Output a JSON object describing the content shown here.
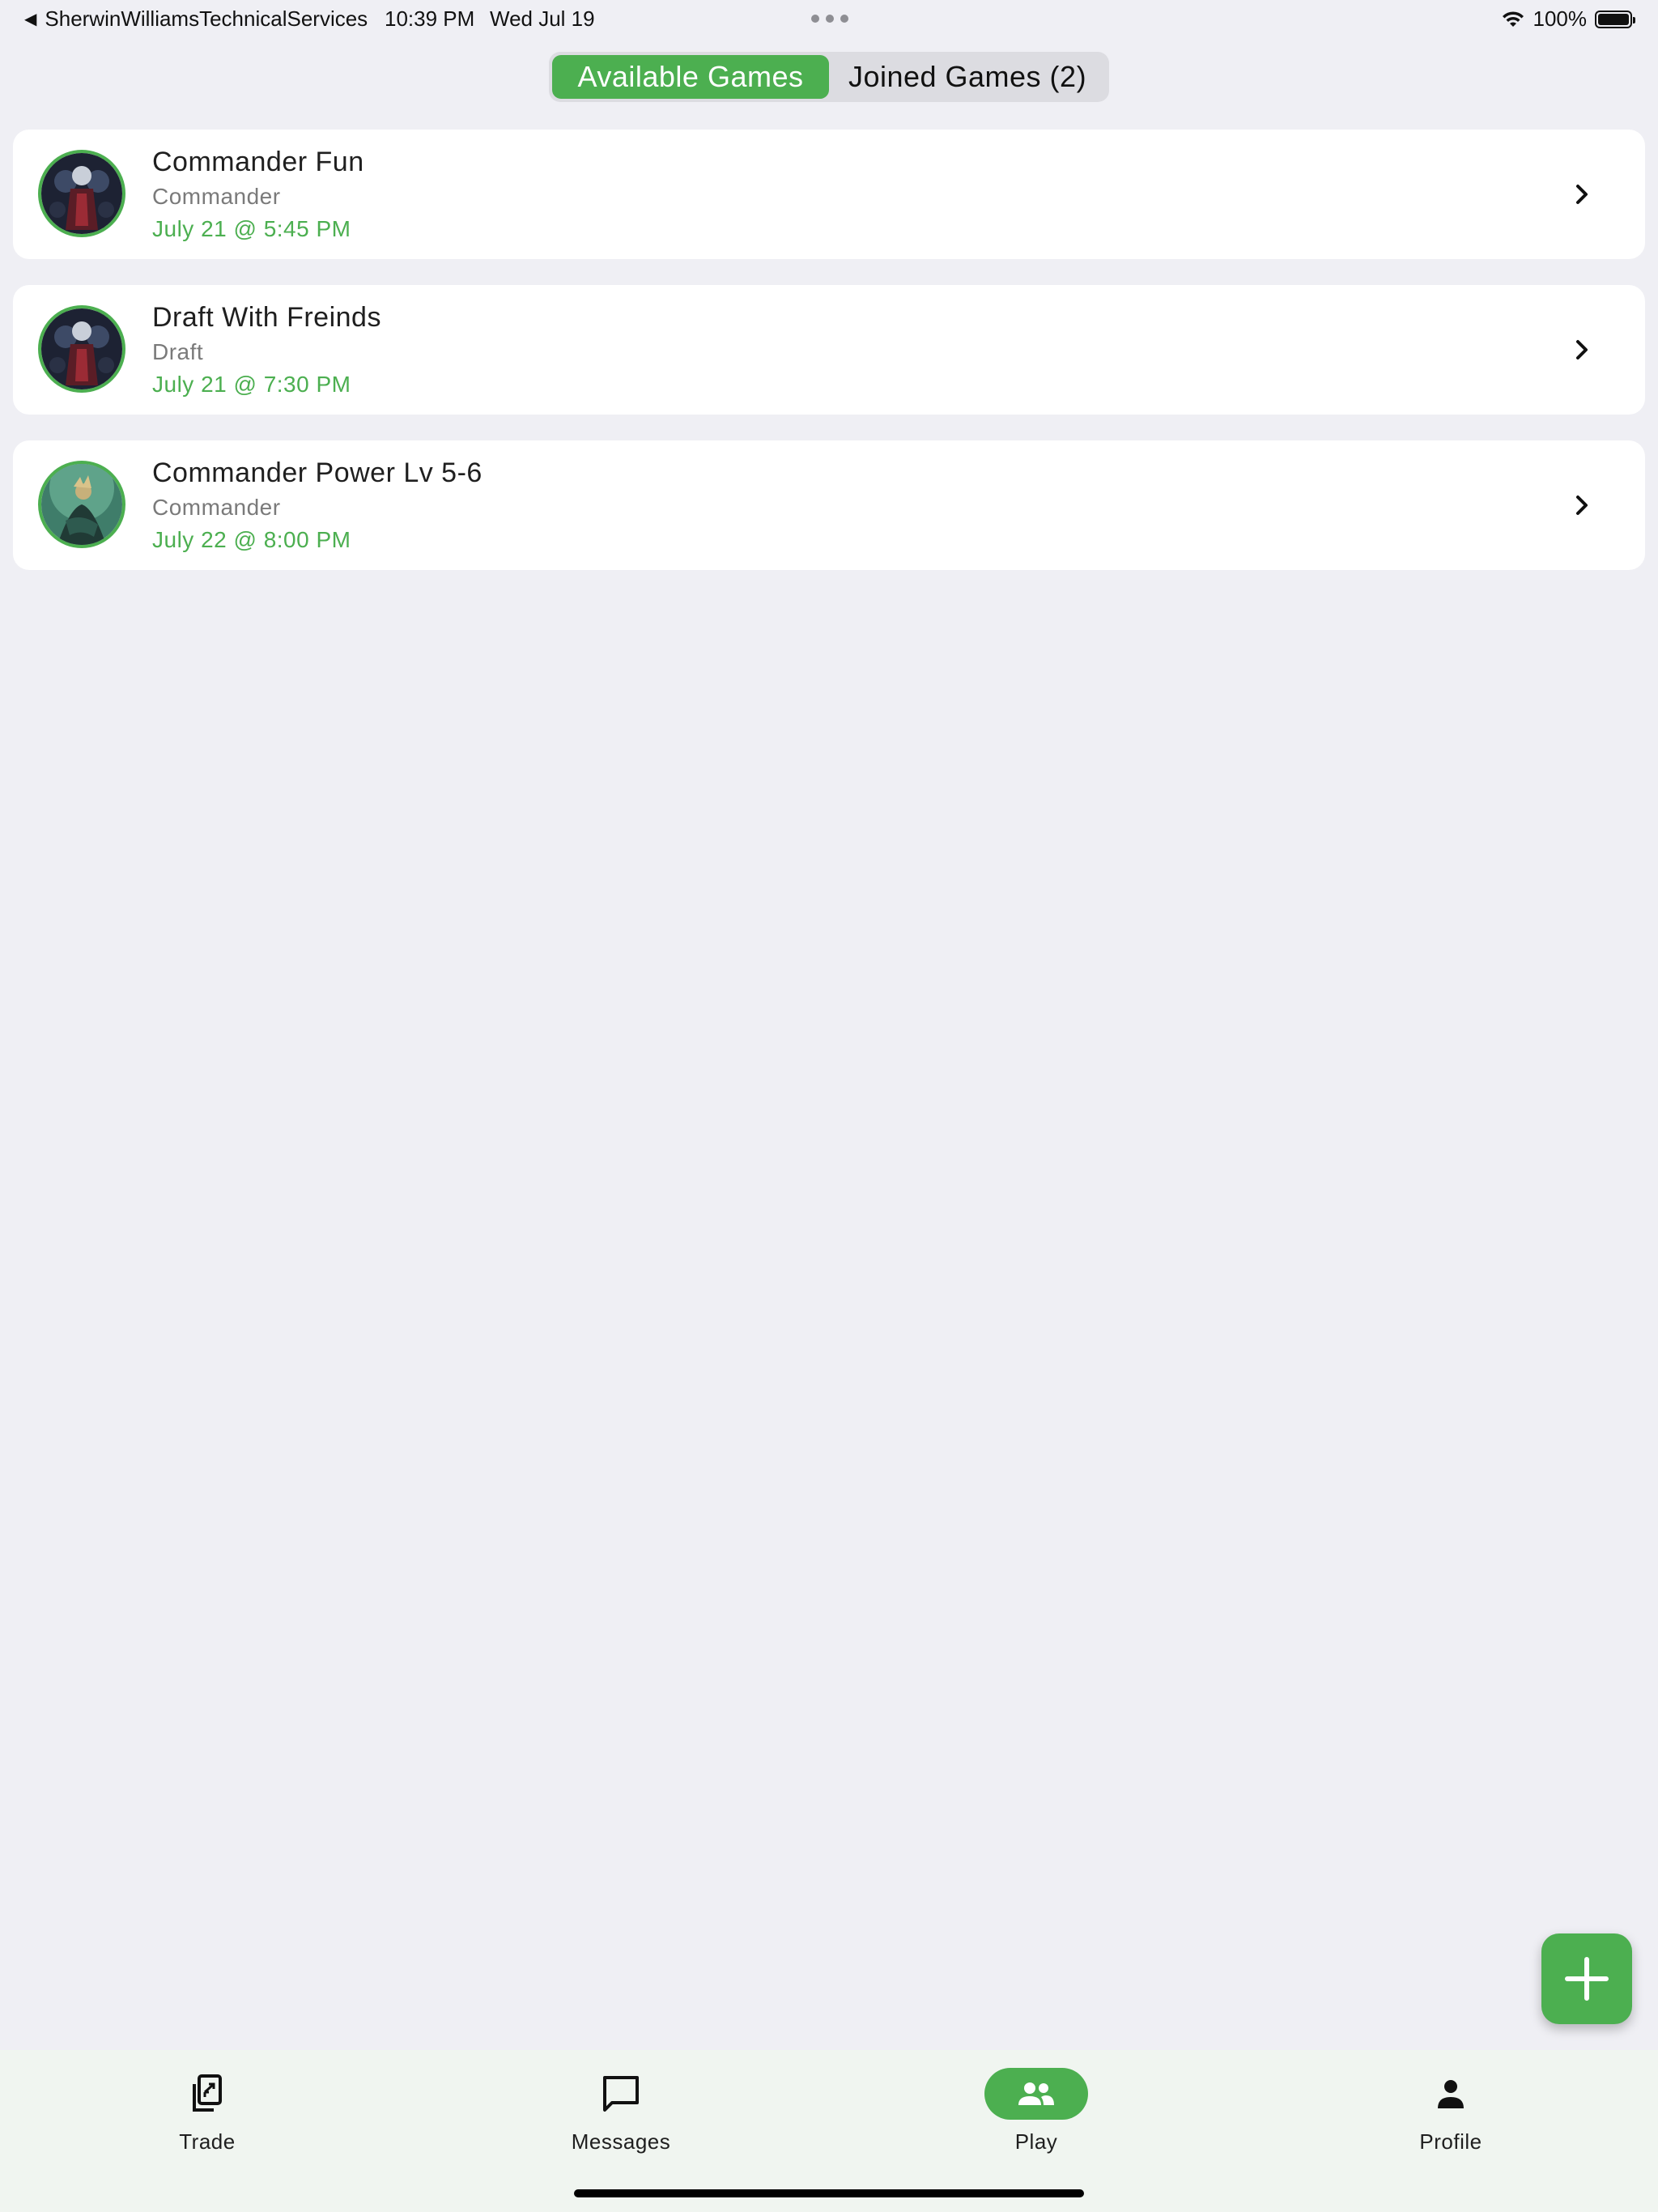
{
  "status_bar": {
    "back_app": "SherwinWilliamsTechnicalServices",
    "time": "10:39 PM",
    "date": "Wed Jul 19",
    "battery_text": "100%",
    "battery_level": 1.0
  },
  "tabs": {
    "available_label": "Available Games",
    "joined_label": "Joined Games (2)",
    "active": "available"
  },
  "games": [
    {
      "title": "Commander Fun",
      "format": "Commander",
      "time": "July 21 @ 5:45 PM",
      "avatar": "dark-knight-avatar"
    },
    {
      "title": "Draft With Freinds",
      "format": "Draft",
      "time": "July 21 @ 7:30 PM",
      "avatar": "dark-knight-avatar"
    },
    {
      "title": "Commander Power Lv 5-6",
      "format": "Commander",
      "time": "July 22 @ 8:00 PM",
      "avatar": "forest-warrior-avatar"
    }
  ],
  "fab": {
    "icon": "plus-icon"
  },
  "bottom_nav": {
    "items": [
      {
        "label": "Trade",
        "icon": "trade-cards-icon"
      },
      {
        "label": "Messages",
        "icon": "chat-bubble-icon"
      },
      {
        "label": "Play",
        "icon": "people-icon",
        "active": true
      },
      {
        "label": "Profile",
        "icon": "person-icon"
      }
    ]
  },
  "colors": {
    "accent": "#4caf50",
    "background": "#efeff4",
    "card": "#ffffff",
    "nav_background": "#f0f5f0"
  }
}
